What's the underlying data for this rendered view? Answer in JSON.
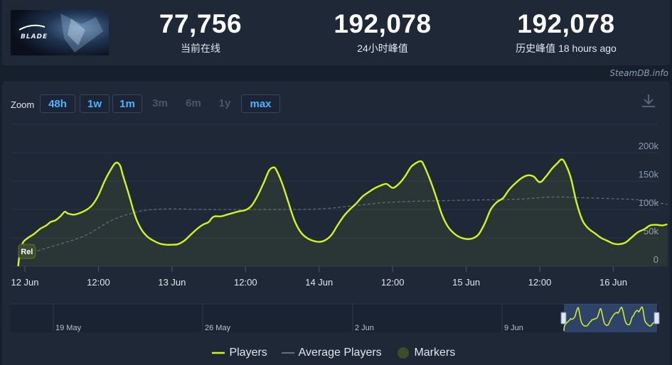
{
  "header": {
    "game_art": "stellar-blade-key-art",
    "stats": [
      {
        "value": "77,756",
        "label": "当前在线"
      },
      {
        "value": "192,078",
        "label": "24小时峰值"
      },
      {
        "value": "192,078",
        "label": "历史峰值 18 hours ago"
      }
    ],
    "watermark": "SteamDB.info"
  },
  "toolbar": {
    "zoom_label": "Zoom",
    "zoom_buttons": [
      {
        "label": "48h",
        "enabled": true
      },
      {
        "label": "1w",
        "enabled": true
      },
      {
        "label": "1m",
        "enabled": true
      },
      {
        "label": "3m",
        "enabled": false
      },
      {
        "label": "6m",
        "enabled": false
      },
      {
        "label": "1y",
        "enabled": false
      },
      {
        "label": "max",
        "enabled": true
      }
    ],
    "download_icon": "download-icon"
  },
  "chart_data": {
    "type": "line",
    "x_unit": "hours since 12 Jun 00:00",
    "y_ticks": [
      "0",
      "50k",
      "100k",
      "150k",
      "200k"
    ],
    "ylim": [
      0,
      200000
    ],
    "grid": true,
    "x_tick_labels": [
      {
        "h": 0,
        "label": "12 Jun"
      },
      {
        "h": 12,
        "label": "12:00"
      },
      {
        "h": 24,
        "label": "13 Jun"
      },
      {
        "h": 36,
        "label": "12:00"
      },
      {
        "h": 48,
        "label": "14 Jun"
      },
      {
        "h": 60,
        "label": "12:00"
      },
      {
        "h": 72,
        "label": "15 Jun"
      },
      {
        "h": 84,
        "label": "12:00"
      },
      {
        "h": 96,
        "label": "16 Jun"
      }
    ],
    "series": [
      {
        "name": "Players",
        "color": "#d4f51c",
        "points": [
          [
            -1.1,
            0
          ],
          [
            -0.8,
            25000
          ],
          [
            -0.3,
            42000
          ],
          [
            0.5,
            50000
          ],
          [
            1.5,
            57000
          ],
          [
            2.5,
            66000
          ],
          [
            3.5,
            72000
          ],
          [
            4.2,
            78000
          ],
          [
            5,
            81000
          ],
          [
            5.8,
            88000
          ],
          [
            6.5,
            96000
          ],
          [
            7,
            93000
          ],
          [
            8,
            91000
          ],
          [
            9,
            94000
          ],
          [
            10,
            99000
          ],
          [
            11,
            108000
          ],
          [
            12,
            125000
          ],
          [
            13,
            150000
          ],
          [
            14,
            170000
          ],
          [
            14.8,
            182000
          ],
          [
            15.5,
            178000
          ],
          [
            16,
            160000
          ],
          [
            17,
            125000
          ],
          [
            18,
            88000
          ],
          [
            19,
            65000
          ],
          [
            20,
            52000
          ],
          [
            21,
            45000
          ],
          [
            22,
            40000
          ],
          [
            23,
            38000
          ],
          [
            24,
            38000
          ],
          [
            25,
            39000
          ],
          [
            26,
            45000
          ],
          [
            27,
            55000
          ],
          [
            28,
            65000
          ],
          [
            29,
            73000
          ],
          [
            30,
            78000
          ],
          [
            30.5,
            85000
          ],
          [
            31,
            88000
          ],
          [
            32,
            88000
          ],
          [
            33,
            91000
          ],
          [
            34,
            94000
          ],
          [
            35,
            97000
          ],
          [
            36,
            99000
          ],
          [
            37,
            107000
          ],
          [
            38,
            125000
          ],
          [
            39,
            148000
          ],
          [
            39.8,
            168000
          ],
          [
            40.5,
            174000
          ],
          [
            41,
            170000
          ],
          [
            42,
            145000
          ],
          [
            43,
            112000
          ],
          [
            44,
            80000
          ],
          [
            45,
            60000
          ],
          [
            46,
            50000
          ],
          [
            47,
            45000
          ],
          [
            48,
            43000
          ],
          [
            49,
            46000
          ],
          [
            50,
            55000
          ],
          [
            51,
            72000
          ],
          [
            52,
            88000
          ],
          [
            53,
            100000
          ],
          [
            54,
            110000
          ],
          [
            55,
            122000
          ],
          [
            56,
            130000
          ],
          [
            57,
            137000
          ],
          [
            58,
            142000
          ],
          [
            59,
            145000
          ],
          [
            60,
            138000
          ],
          [
            61,
            145000
          ],
          [
            62,
            158000
          ],
          [
            63,
            175000
          ],
          [
            64,
            183000
          ],
          [
            64.6,
            185000
          ],
          [
            65,
            180000
          ],
          [
            66,
            155000
          ],
          [
            67,
            125000
          ],
          [
            68,
            92000
          ],
          [
            69,
            70000
          ],
          [
            70,
            58000
          ],
          [
            71,
            51000
          ],
          [
            72,
            48000
          ],
          [
            73,
            49000
          ],
          [
            74,
            56000
          ],
          [
            75,
            75000
          ],
          [
            76,
            100000
          ],
          [
            77,
            113000
          ],
          [
            78,
            120000
          ],
          [
            79,
            135000
          ],
          [
            80,
            146000
          ],
          [
            81,
            155000
          ],
          [
            82,
            160000
          ],
          [
            83,
            158000
          ],
          [
            84,
            148000
          ],
          [
            85,
            158000
          ],
          [
            86,
            172000
          ],
          [
            87,
            183000
          ],
          [
            87.5,
            188000
          ],
          [
            88,
            184000
          ],
          [
            89,
            158000
          ],
          [
            90,
            112000
          ],
          [
            91,
            80000
          ],
          [
            92,
            66000
          ],
          [
            93,
            58000
          ],
          [
            94,
            50000
          ],
          [
            95,
            45000
          ],
          [
            96,
            40000
          ],
          [
            97,
            39000
          ],
          [
            98,
            42000
          ],
          [
            99,
            51000
          ],
          [
            100,
            60000
          ],
          [
            101,
            65000
          ],
          [
            102,
            72000
          ],
          [
            103,
            73000
          ],
          [
            104,
            72000
          ],
          [
            104.8,
            74000
          ]
        ]
      },
      {
        "name": "Average Players",
        "color": "#6a6f77",
        "points": [
          [
            -1.0,
            15000
          ],
          [
            2,
            27000
          ],
          [
            6,
            40000
          ],
          [
            10,
            55000
          ],
          [
            14,
            80000
          ],
          [
            17,
            92000
          ],
          [
            20,
            99000
          ],
          [
            24,
            101000
          ],
          [
            30,
            100000
          ],
          [
            40,
            100000
          ],
          [
            48,
            101000
          ],
          [
            54,
            107000
          ],
          [
            60,
            113000
          ],
          [
            70,
            116000
          ],
          [
            80,
            118000
          ],
          [
            86,
            122000
          ],
          [
            90,
            121000
          ],
          [
            96,
            119000
          ],
          [
            100,
            117000
          ],
          [
            104.8,
            109000
          ]
        ]
      }
    ],
    "annotations": [
      {
        "h": -0.6,
        "label": "Rel"
      }
    ],
    "navigator": {
      "labels": [
        "19 May",
        "26 May",
        "2 Jun",
        "9 Jun"
      ]
    },
    "legend": [
      {
        "name": "Players",
        "color": "#d4f51c"
      },
      {
        "name": "Average Players",
        "color": "#6a6f77"
      },
      {
        "name": "Markers",
        "color": "#3d4c2a"
      }
    ]
  }
}
